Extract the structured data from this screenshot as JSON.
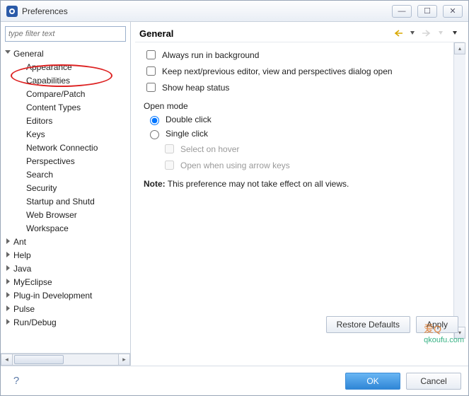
{
  "window": {
    "title": "Preferences"
  },
  "filter": {
    "placeholder": "type filter text"
  },
  "tree": {
    "general": "General",
    "children": [
      "Appearance",
      "Capabilities",
      "Compare/Patch",
      "Content Types",
      "Editors",
      "Keys",
      "Network Connectio",
      "Perspectives",
      "Search",
      "Security",
      "Startup and Shutd",
      "Web Browser",
      "Workspace"
    ],
    "tops": [
      "Ant",
      "Help",
      "Java",
      "MyEclipse",
      "Plug-in Development",
      "Pulse",
      "Run/Debug"
    ]
  },
  "page": {
    "heading": "General",
    "cb_background": "Always run in background",
    "cb_keepnext": "Keep next/previous editor, view and perspectives dialog open",
    "cb_heap": "Show heap status",
    "openmode": "Open mode",
    "rb_double": "Double click",
    "rb_single": "Single click",
    "cb_hover": "Select on hover",
    "cb_arrow": "Open when using arrow keys",
    "note_label": "Note:",
    "note_text": " This preference may not take effect on all views."
  },
  "buttons": {
    "restore": "Restore Defaults",
    "apply": "Apply",
    "ok": "OK",
    "cancel": "Cancel"
  }
}
